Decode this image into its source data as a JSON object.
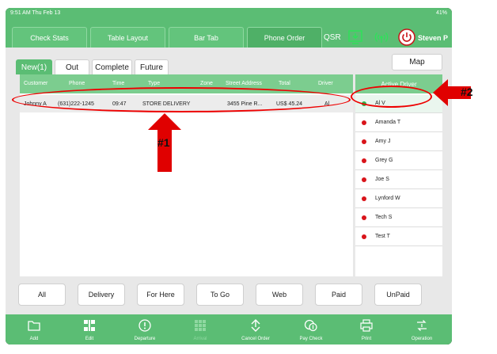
{
  "statusbar": {
    "left": "9:51 AM  Thu Feb 13",
    "right": "41%"
  },
  "topnav": {
    "tabs": [
      {
        "label": "Check Stats"
      },
      {
        "label": "Table Layout"
      },
      {
        "label": "Bar Tab"
      },
      {
        "label": "Phone Order"
      }
    ],
    "qsr": "QSR",
    "user": "Steven P"
  },
  "subtabs": [
    "New(1)",
    "Out",
    "Complete",
    "Future"
  ],
  "map_label": "Map",
  "orders": {
    "columns": [
      "Customer",
      "Phone",
      "Time",
      "Type",
      "Zone",
      "Street Address",
      "Total",
      "Driver"
    ],
    "rows": [
      {
        "customer": "Johnny A",
        "phone": "(631)222-1245",
        "time": "09:47",
        "type": "STORE DELIVERY",
        "zone": "",
        "address": "3455  Pine R...",
        "total": "US$ 45.24",
        "driver": "Al"
      }
    ]
  },
  "drivers": {
    "header": "Active Driver",
    "items": [
      {
        "name": "Al V",
        "status_color": "#2db34a"
      },
      {
        "name": "Amanda T",
        "status_color": "#d9141a"
      },
      {
        "name": "Amy J",
        "status_color": "#d9141a"
      },
      {
        "name": "Grey G",
        "status_color": "#d9141a"
      },
      {
        "name": "Joe S",
        "status_color": "#d9141a"
      },
      {
        "name": "Lynford W",
        "status_color": "#d9141a"
      },
      {
        "name": "Tech S",
        "status_color": "#d9141a"
      },
      {
        "name": "Test T",
        "status_color": "#d9141a"
      }
    ]
  },
  "filters": [
    "All",
    "Delivery",
    "For Here",
    "To Go",
    "Web",
    "Paid",
    "UnPaid"
  ],
  "toolbar": [
    {
      "label": "Add",
      "icon": "folder-icon"
    },
    {
      "label": "Edit",
      "icon": "grid-edit-icon"
    },
    {
      "label": "Departure",
      "icon": "alert-circle-icon"
    },
    {
      "label": "Arrival",
      "icon": "grid-disabled-icon"
    },
    {
      "label": "Cancel Order",
      "icon": "swap-arrows-icon"
    },
    {
      "label": "Pay Check",
      "icon": "coins-icon"
    },
    {
      "label": "Print",
      "icon": "printer-icon"
    },
    {
      "label": "Operation",
      "icon": "dollar-swap-icon"
    }
  ],
  "annotations": {
    "first": "#1",
    "second": "#2"
  },
  "colors": {
    "brand_green": "#5bbd74",
    "header_green": "#7ccd8f",
    "arrow_red": "#e00000"
  }
}
